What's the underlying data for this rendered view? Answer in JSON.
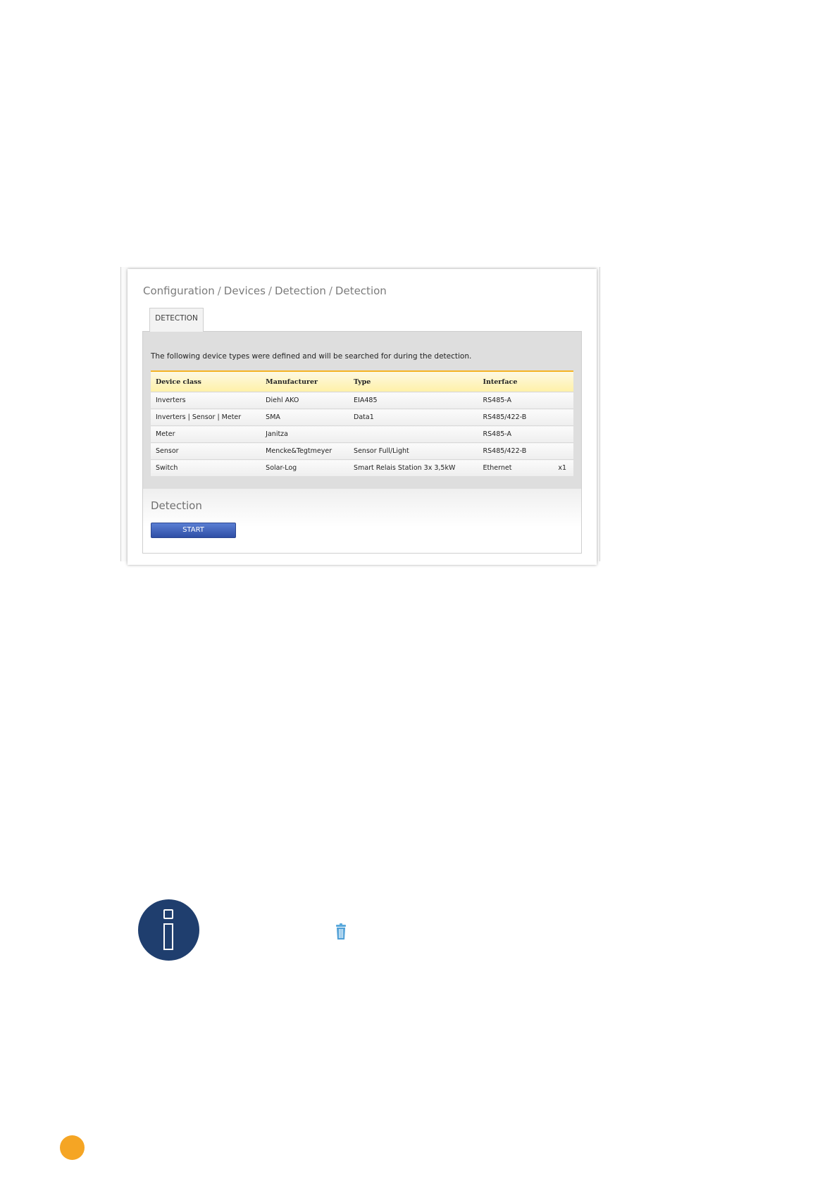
{
  "breadcrumb": [
    "Configuration",
    "Devices",
    "Detection",
    "Detection"
  ],
  "tab": {
    "label": "DETECTION"
  },
  "description": "The following device types were defined and will be searched for during the detection.",
  "table": {
    "headers": [
      "Device class",
      "Manufacturer",
      "Type",
      "Interface",
      ""
    ],
    "rows": [
      [
        "Inverters",
        "Diehl AKO",
        "EIA485",
        "RS485-A",
        ""
      ],
      [
        "Inverters | Sensor | Meter",
        "SMA",
        "Data1",
        "RS485/422-B",
        ""
      ],
      [
        "Meter",
        "Janitza",
        "",
        "RS485-A",
        ""
      ],
      [
        "Sensor",
        "Mencke&Tegtmeyer",
        "Sensor Full/Light",
        "RS485/422-B",
        ""
      ],
      [
        "Switch",
        "Solar-Log",
        "Smart Relais Station 3x 3,5kW",
        "Ethernet",
        "x1"
      ]
    ]
  },
  "detection": {
    "title": "Detection",
    "start_label": "START"
  },
  "icons": {
    "info": "info-icon",
    "trash": "trash-icon",
    "page_marker": "orange-dot"
  },
  "colors": {
    "accent_orange": "#f5a524",
    "header_border": "#f5b324",
    "button_blue": "#3d5fb8",
    "info_navy": "#1f3e6e"
  }
}
